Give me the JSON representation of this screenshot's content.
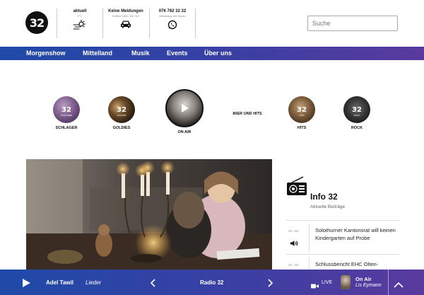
{
  "brand": {
    "logo_text": "32"
  },
  "header": {
    "weather": {
      "title": "aktuell",
      "value": "2°C"
    },
    "traffic": {
      "title": "Keine Meldungen",
      "sub": "Hotline 0800 332 332"
    },
    "whatsapp": {
      "title": "076 762 32 32",
      "sub": "WhatsApp ins Studio"
    },
    "search_placeholder": "Suche"
  },
  "nav": [
    "Morgenshow",
    "Mittelland",
    "Musik",
    "Events",
    "Über uns"
  ],
  "channels": [
    {
      "name": "SCHLAGER",
      "logo": "32",
      "sublabel": "SCHLAGER",
      "color": "#7a5a8a"
    },
    {
      "name": "GOLDIES",
      "logo": "32",
      "sublabel": "GOLDIES",
      "color": "#3a2a1a"
    },
    {
      "name": "ON AIR",
      "logo": "",
      "sublabel": "",
      "color": "#2a2a2a"
    },
    {
      "name": "80ER UND HITS",
      "logo": "",
      "sublabel": "",
      "color": "#ffffff"
    },
    {
      "name": "HITS",
      "logo": "32",
      "sublabel": "HITS",
      "color": "#8a6a4a"
    },
    {
      "name": "ROCK",
      "logo": "32",
      "sublabel": "ROCK",
      "color": "#2a2a2a"
    }
  ],
  "info": {
    "title": "Info 32",
    "subtitle": "Aktuelle Beiträge",
    "items": [
      {
        "date": "26. Jan",
        "title": "Solothurner Kantonsrat will keinen Kindergarten auf Probe"
      },
      {
        "date": "25. Jan",
        "title": "Schlussbericht EHC Olten-"
      }
    ]
  },
  "player": {
    "artist": "Adel Tawil",
    "song": "Lieder",
    "station": "Radio 32",
    "live_label": "LIVE",
    "on_air_label": "On Air",
    "host": "Lis Eymann"
  },
  "colors": {
    "nav_start": "#1f4aa8",
    "nav_end": "#5a3a9e"
  }
}
